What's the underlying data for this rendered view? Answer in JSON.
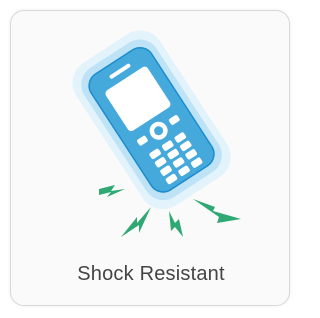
{
  "card": {
    "label": "Shock Resistant",
    "icon": "shock-resistant-phone-icon"
  },
  "colors": {
    "phone_body": "#45a9dc",
    "phone_outline": "#1d8ccc",
    "glow_outer": "#d2ebf8",
    "glow_inner": "#a9d8f2",
    "screen": "#ffffff",
    "bolt": "#2fa873",
    "label": "#444444"
  }
}
